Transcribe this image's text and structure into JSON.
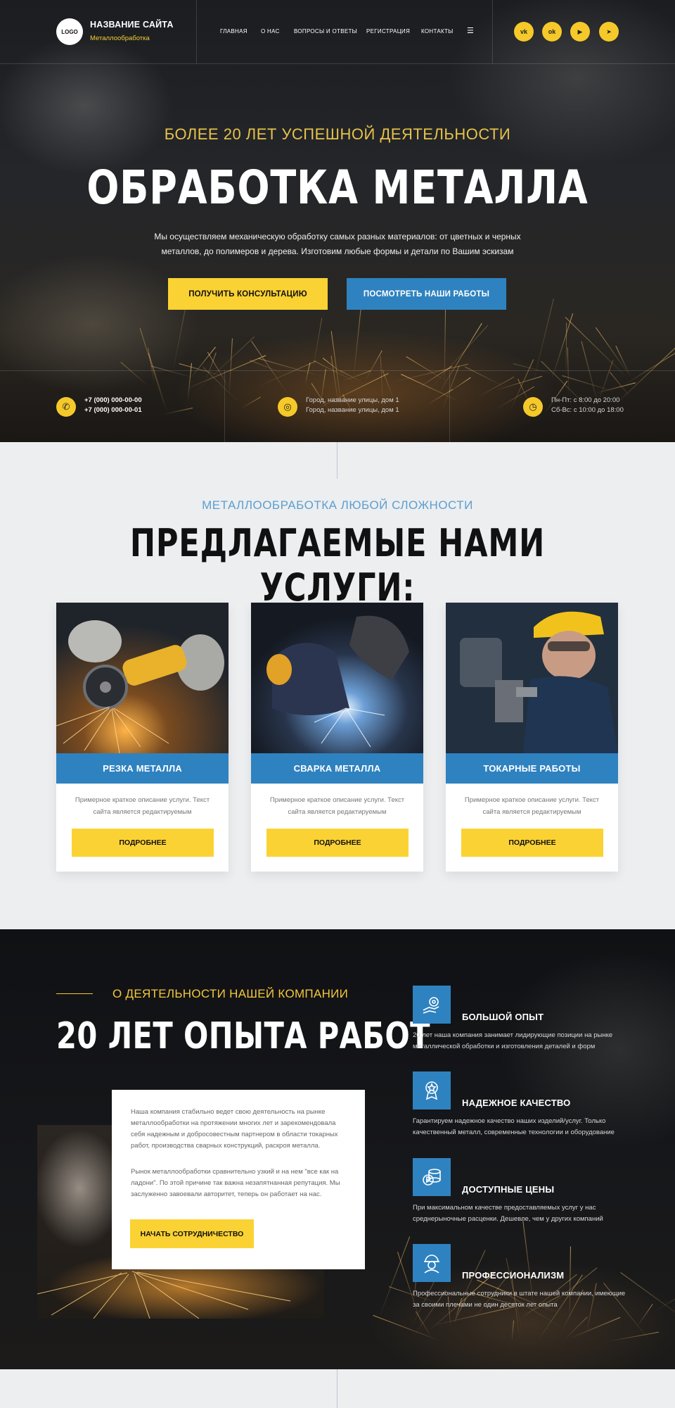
{
  "header": {
    "logo_text": "LOGO",
    "site_name": "НАЗВАНИЕ САЙТА",
    "site_subtitle": "Металлообработка",
    "nav": [
      "ГЛАВНАЯ",
      "О НАС",
      "ВОПРОСЫ И ОТВЕТЫ",
      "РЕГИСТРАЦИЯ",
      "КОНТАКТЫ"
    ],
    "menu_icon": "menu-icon",
    "socials": [
      {
        "name": "vk-icon",
        "glyph": "vk"
      },
      {
        "name": "odnoklassniki-icon",
        "glyph": "ok"
      },
      {
        "name": "youtube-icon",
        "glyph": "▶"
      },
      {
        "name": "telegram-icon",
        "glyph": "➤"
      }
    ]
  },
  "hero": {
    "kicker": "БОЛЕЕ 20 ЛЕТ УСПЕШНОЙ ДЕЯТЕЛЬНОСТИ",
    "title": "ОБРАБОТКА МЕТАЛЛА",
    "description": "Мы осуществляем механическую обработку самых разных материалов: от цветных и черных металлов, до полимеров и дерева. Изготовим любые формы и детали по Вашим эскизам",
    "btn_consult": "ПОЛУЧИТЬ КОНСУЛЬТАЦИЮ",
    "btn_works": "ПОСМОТРЕТЬ НАШИ РАБОТЫ"
  },
  "contacts": {
    "phone1": "+7 (000) 000-00-00",
    "phone2": "+7 (000) 000-00-01",
    "address1": "Город, название улицы, дом 1",
    "address2": "Город, название улицы, дом 1",
    "hours1": "Пн-Пт: с 8:00 до 20:00",
    "hours2": "Сб-Вс: с 10:00 до 18:00"
  },
  "services": {
    "kicker": "МЕТАЛЛООБРАБОТКА ЛЮБОЙ СЛОЖНОСТИ",
    "title": "ПРЕДЛАГАЕМЫЕ НАМИ УСЛУГИ:",
    "cards": [
      {
        "title": "РЕЗКА МЕТАЛЛА",
        "desc": "Примерное краткое описание услуги. Текст сайта является редактируемым",
        "button": "ПОДРОБНЕЕ"
      },
      {
        "title": "СВАРКА МЕТАЛЛА",
        "desc": "Примерное краткое описание услуги. Текст сайта является редактируемым",
        "button": "ПОДРОБНЕЕ"
      },
      {
        "title": "ТОКАРНЫЕ РАБОТЫ",
        "desc": "Примерное краткое описание услуги. Текст сайта является редактируемым",
        "button": "ПОДРОБНЕЕ"
      }
    ]
  },
  "about": {
    "kicker": "О ДЕЯТЕЛЬНОСТИ НАШЕЙ КОМПАНИИ",
    "title": "20 ЛЕТ ОПЫТА РАБОТ",
    "p1": "Наша компания стабильно ведет свою деятельность на рынке металлообработки на протяжении многих лет и зарекомендовала себя надежным и добросовестным партнером в области токарных работ, производства сварных конструкций, раскроя металла.",
    "p2": "Рынок металлообработки сравнительно узкий и на нем \"все как на ладони\". По этой причине так важна незапятнанная репутация. Мы заслуженно завоевали авторитет, теперь он работает на нас.",
    "button": "НАЧАТЬ СОТРУДНИЧЕСТВО",
    "features": [
      {
        "icon": "gear-hand-icon",
        "title": "БОЛЬШОЙ ОПЫТ",
        "desc": "20 лет наша компания занимает лидирующие позиции на рынке металлической обработки и изготовления деталей и форм"
      },
      {
        "icon": "award-star-icon",
        "title": "НАДЕЖНОЕ КАЧЕСТВО",
        "desc": "Гарантируем надежное качество наших изделий/услуг. Только качественный металл, современные технологии и оборудование"
      },
      {
        "icon": "coins-ruble-icon",
        "title": "ДОСТУПНЫЕ ЦЕНЫ",
        "desc": "При максимальном качестве предоставляемых услуг у нас среднерыночные расценки. Дешевле, чем у других компаний"
      },
      {
        "icon": "worker-helmet-icon",
        "title": "ПРОФЕССИОНАЛИЗМ",
        "desc": "Профессиональные сотрудники в штате нашей компании, имеющие за своими плечами не один десяток лет опыта"
      }
    ]
  }
}
